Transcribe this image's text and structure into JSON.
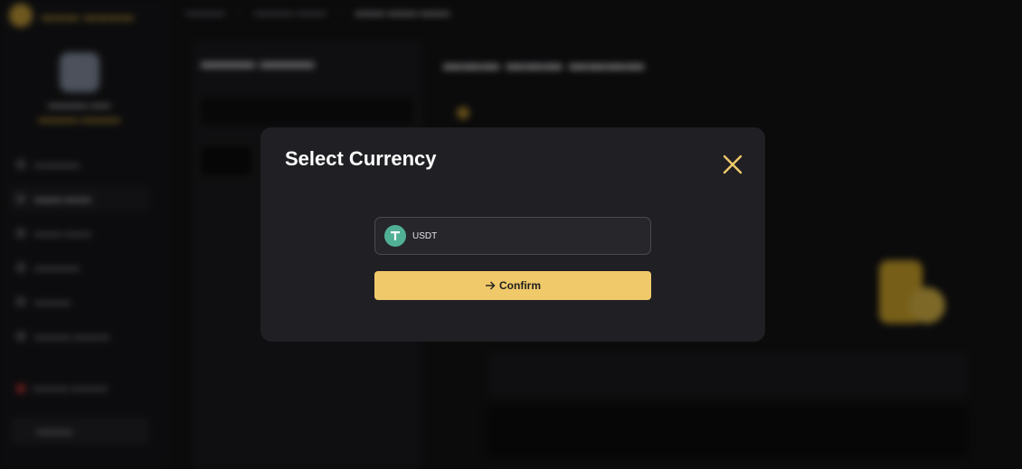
{
  "modal": {
    "title": "Select Currency",
    "currency": {
      "label": "USDT",
      "icon": "tether-icon",
      "icon_color": "#50af95"
    },
    "confirm_label": "Confirm",
    "accent_color": "#f0c96a",
    "close_icon": "close-icon"
  }
}
